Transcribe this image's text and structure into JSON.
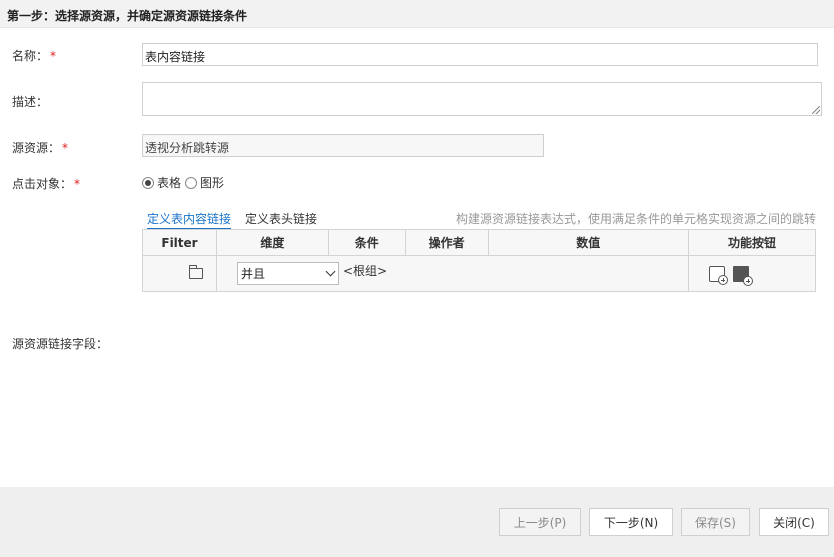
{
  "step": {
    "title": "第一步：选择源资源，并确定源资源链接条件"
  },
  "form": {
    "name_label": "名称：",
    "name_value": "表内容链接",
    "desc_label": "描述：",
    "desc_value": "",
    "source_label": "源资源：",
    "source_value": "透视分析跳转源",
    "click_target_label": "点击对象：",
    "required_mark": "*",
    "radio_options": [
      {
        "label": "表格",
        "checked": true
      },
      {
        "label": "图形",
        "checked": false
      }
    ],
    "source_fields_label": "源资源链接字段："
  },
  "tabs": [
    {
      "label": "定义表内容链接",
      "active": true
    },
    {
      "label": "定义表头链接",
      "active": false
    }
  ],
  "hint": "构建源资源链接表达式，使用满足条件的单元格实现资源之间的跳转",
  "grid": {
    "headers": [
      "Filter",
      "维度",
      "条件",
      "操作者",
      "数值",
      "功能按钮"
    ],
    "row": {
      "logic_value": "并且",
      "root_group": "<根组>",
      "icons": [
        "add-condition-icon",
        "add-group-icon"
      ]
    }
  },
  "buttons": {
    "prev": "上一步(P)",
    "next": "下一步(N)",
    "save": "保存(S)",
    "close": "关闭(C)"
  },
  "colors": {
    "accent": "#1a73c8",
    "required": "#e02020",
    "header_bg": "#f2f2f2",
    "footer_bg": "#efefef"
  }
}
